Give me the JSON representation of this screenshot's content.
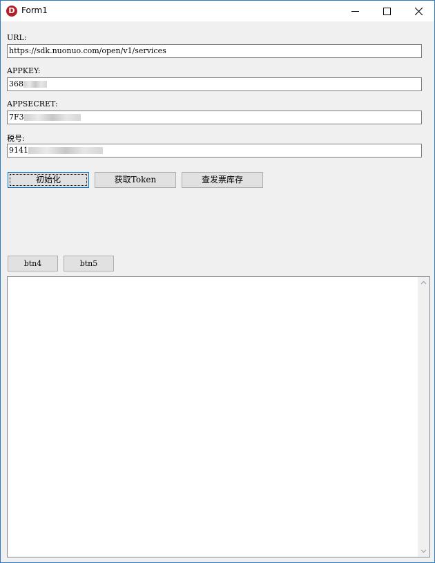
{
  "window": {
    "title": "Form1",
    "icon": "delphi-d-icon",
    "accent": "#b3202a"
  },
  "title_controls": {
    "minimize": "minimize-icon",
    "maximize": "maximize-icon",
    "close": "close-icon"
  },
  "fields": {
    "url": {
      "label": "URL:",
      "value": "https://sdk.nuonuo.com/open/v1/services"
    },
    "appkey": {
      "label": "APPKEY:",
      "value": "368"
    },
    "appsecret": {
      "label": "APPSECRET:",
      "value": "7F3"
    },
    "taxno": {
      "label": "税号:",
      "value": "9141"
    }
  },
  "buttons": {
    "init": "初始化",
    "get_token": "获取Token",
    "query_stock": "查发票库存",
    "btn4": "btn4",
    "btn5": "btn5"
  },
  "memo": {
    "value": ""
  }
}
